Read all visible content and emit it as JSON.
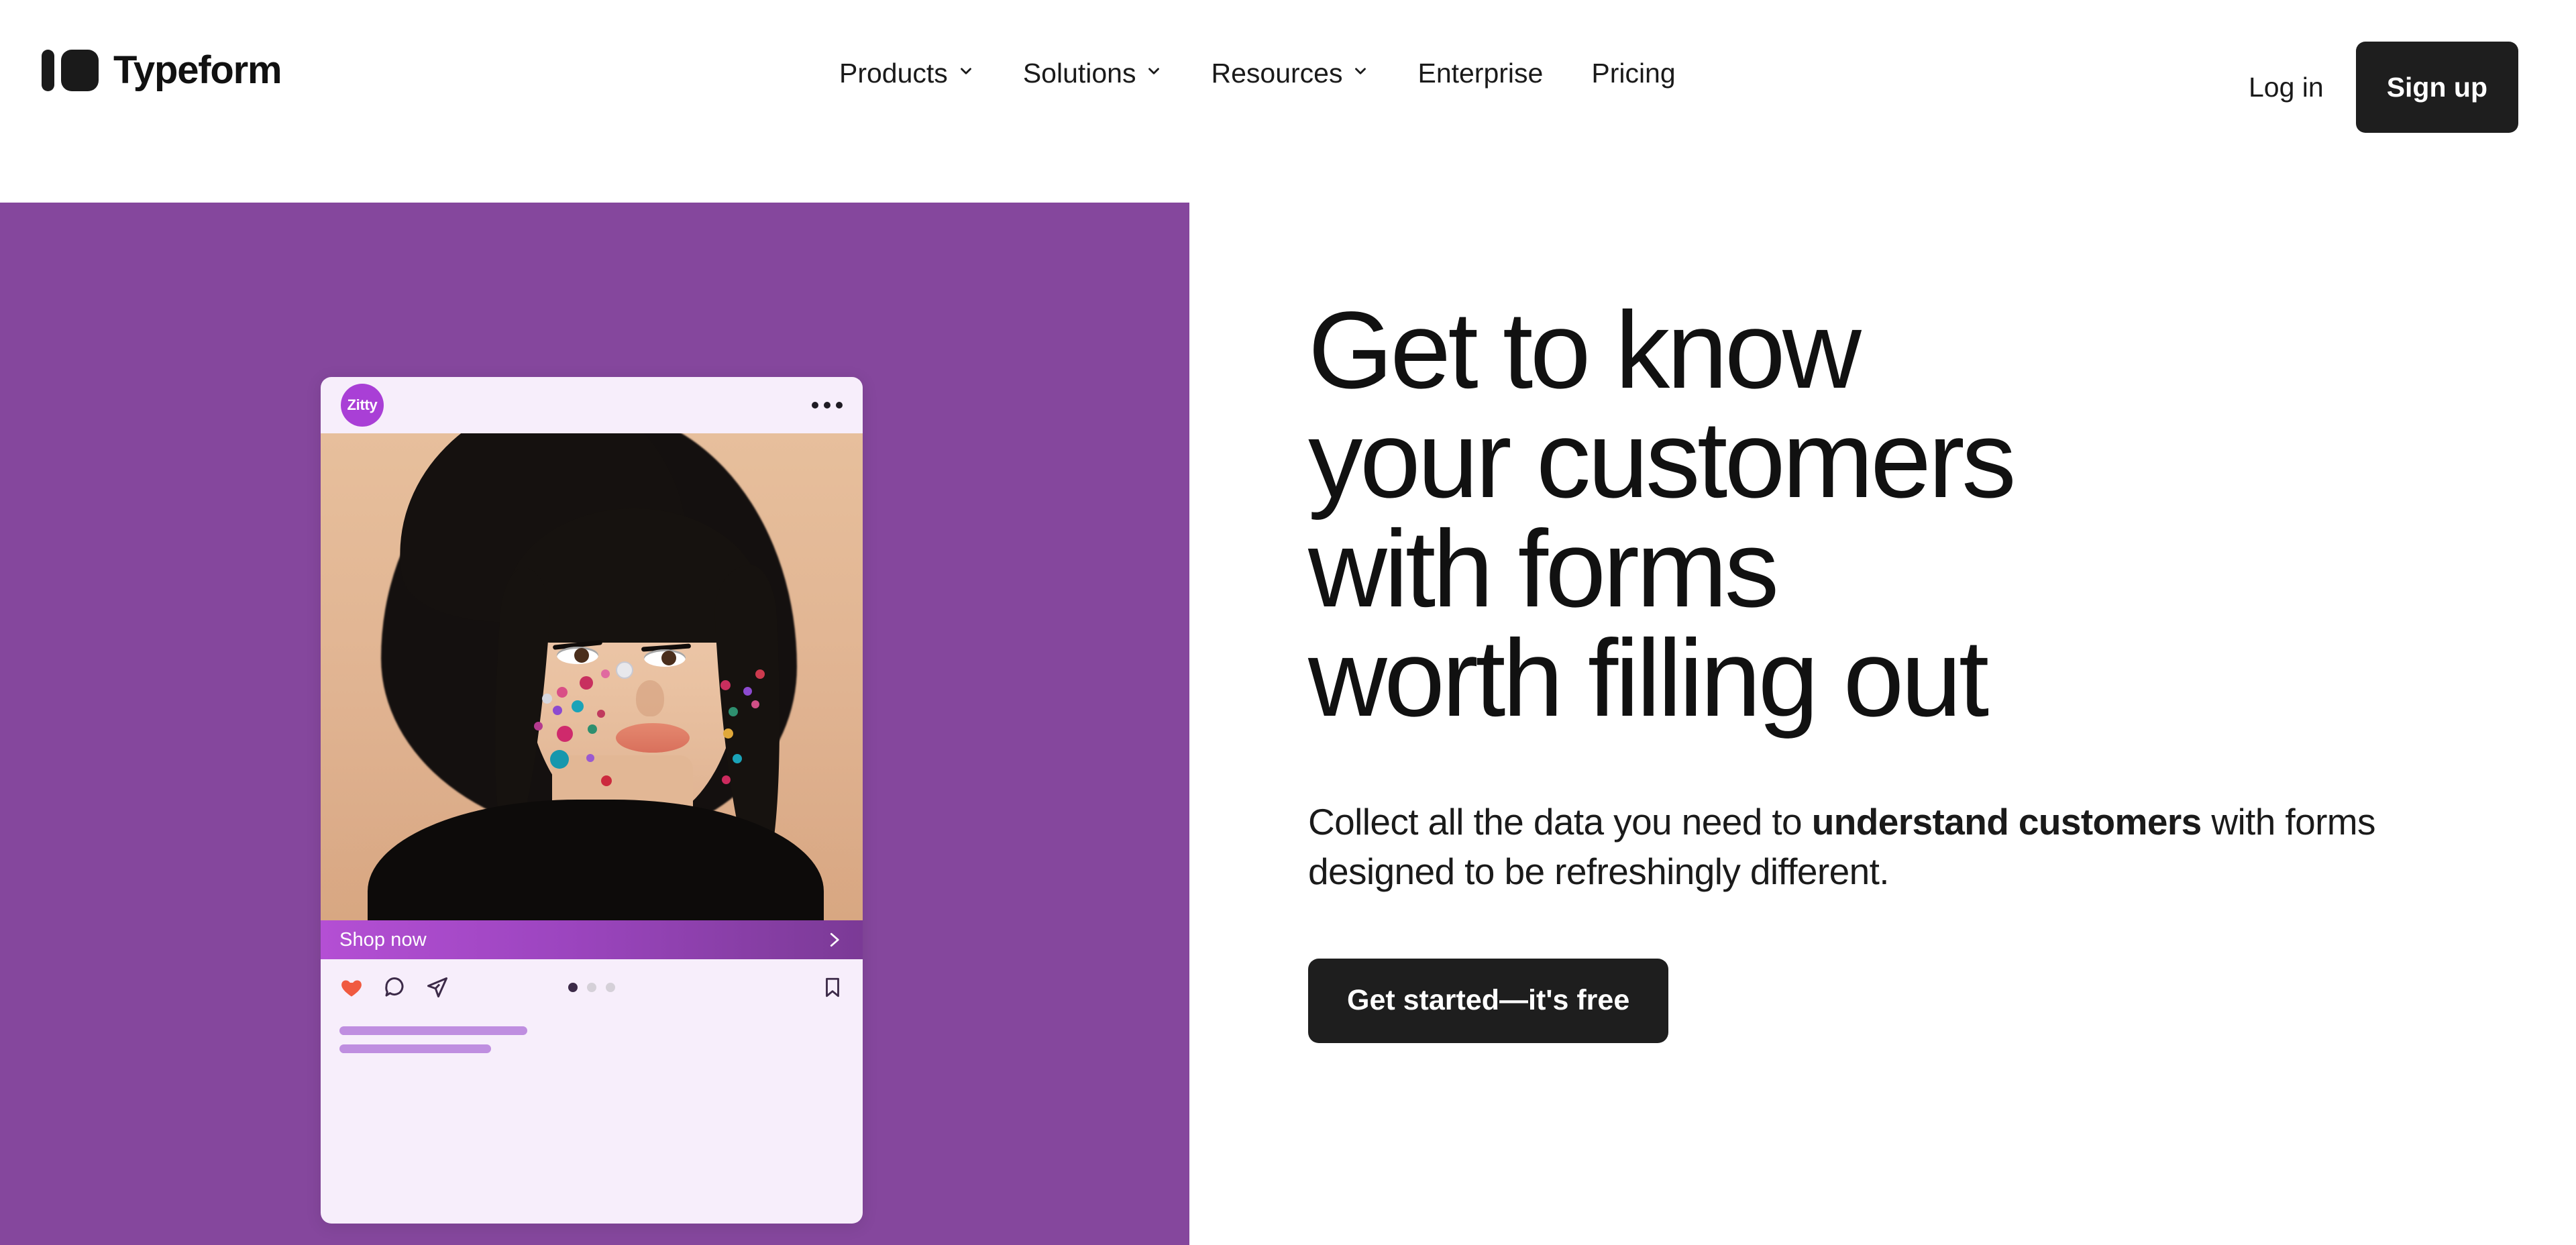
{
  "header": {
    "brand_name": "Typeform",
    "logo_icon": "typeform-logo-icon",
    "nav": [
      {
        "label": "Products",
        "has_dropdown": true,
        "icon": "chevron-down-icon"
      },
      {
        "label": "Solutions",
        "has_dropdown": true,
        "icon": "chevron-down-icon"
      },
      {
        "label": "Resources",
        "has_dropdown": true,
        "icon": "chevron-down-icon"
      },
      {
        "label": "Enterprise",
        "has_dropdown": false
      },
      {
        "label": "Pricing",
        "has_dropdown": false
      }
    ],
    "login_label": "Log in",
    "signup_label": "Sign up"
  },
  "hero": {
    "panel_color": "#85479D",
    "headline_lines": [
      "Get to know",
      "your customers",
      "with forms",
      "worth filling out"
    ],
    "subhead_prefix": "Collect all the data you need to ",
    "subhead_bold": "understand customers",
    "subhead_suffix": " with forms designed to be refreshingly different.",
    "cta_label": "Get started—it's free"
  },
  "social_card": {
    "avatar_label": "Zitty",
    "avatar_color": "#A93FD6",
    "menu_icon": "more-options-icon",
    "photo_alt": "portrait-with-face-gems",
    "shop_label": "Shop now",
    "shop_chevron_icon": "chevron-right-icon",
    "shop_gradient_from": "#B44FD4",
    "shop_gradient_to": "#7B3A96",
    "actions": [
      {
        "icon": "heart-icon",
        "state": "liked",
        "color": "#F05A40"
      },
      {
        "icon": "comment-icon",
        "state": "default",
        "color": "#3C2A48"
      },
      {
        "icon": "share-icon",
        "state": "default",
        "color": "#3C2A48"
      }
    ],
    "save_icon": "bookmark-icon",
    "carousel": {
      "total": 3,
      "active_index": 0,
      "active_color": "#3C2A48",
      "inactive_color": "#D5D0D8"
    },
    "caption_placeholder_color": "#BF8EE0",
    "card_background": "#F7EEFB"
  }
}
